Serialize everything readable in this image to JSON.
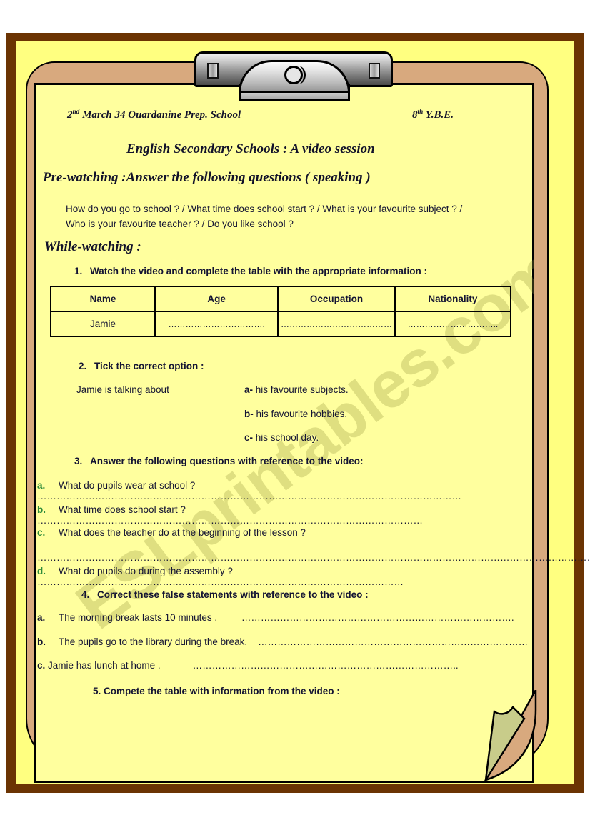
{
  "worksheet": {
    "header": {
      "date_school": "2nd March 34 Ouardanine Prep. School",
      "date_school_sup": "nd",
      "date_school_pre": "2",
      "date_school_post": " March 34 Ouardanine Prep. School",
      "level_pre": "8",
      "level_sup": "th",
      "level_post": " Y.B.E.",
      "level": "8th Y.B.E.",
      "title": "English Secondary Schools : A video session"
    },
    "pre_watching": {
      "heading": "Pre-watching :Answer the following questions ( speaking )",
      "questions_line1": "How do you go to school ? /   What time does school start ?  /  What is your favourite subject ? /",
      "questions_line2": "Who is your favourite teacher ?  /  Do you like school ?"
    },
    "while_watching": {
      "heading": "While-watching :",
      "task1": {
        "number": "1.",
        "text": "Watch the video and complete the table with the appropriate  information :",
        "table": {
          "columns": [
            "Name",
            "Age",
            "Occupation",
            "Nationality"
          ],
          "rows": [
            [
              "Jamie",
              "…………………………….",
              "…………………………………",
              "………………………….."
            ]
          ]
        }
      },
      "task2": {
        "number": "2.",
        "text": "Tick the correct option :",
        "stem": "Jamie is talking about",
        "options": [
          {
            "letter": "a-",
            "text": " his favourite subjects."
          },
          {
            "letter": "b-",
            "text": " his favourite hobbies."
          },
          {
            "letter": "c-",
            "text": " his school day."
          }
        ]
      },
      "task3": {
        "number": "3.",
        "text": "Answer the following questions with reference to the video:",
        "items": [
          {
            "letter": "a.",
            "text": "What do pupils wear at school  ?",
            "dots": "……………………………………………………………………………………………………………………"
          },
          {
            "letter": "b.",
            "text": "What time does school start ?",
            "dots": "…………………………………………………………………………………………………………"
          },
          {
            "letter": "c.",
            "text": "What does the teacher do at the beginning of the lesson ?",
            "dots": "………………………………………………………………………………………………………………………………………………………………………"
          },
          {
            "letter": "d.",
            "text": "What do pupils do during the assembly ?",
            "dots": "……………………………………………………………………………………………………"
          }
        ]
      },
      "task4": {
        "number": "4.",
        "text": "Correct these false statements with reference to the video :",
        "items": [
          {
            "letter": "a.",
            "text": "The morning  break  lasts 10 minutes .",
            "dots": "…………………………………………………………………………."
          },
          {
            "letter": "b.",
            "text": "The pupils go to the library during the break.",
            "dots": "…………………………………………………………………………"
          },
          {
            "letter": "c.",
            "text": "Jamie has lunch at home .",
            "dots": "……………………………………………………………………….."
          }
        ]
      },
      "task5": {
        "number": "5.",
        "text": "Compete the table with information from the video :"
      }
    },
    "watermark": "ESLprintables.com",
    "colors": {
      "outer_frame": "#6b3403",
      "backdrop_yellow": "#ffff80",
      "clipboard_tan": "#d8a97e",
      "paper": "#ffff9e",
      "ink": "#141433",
      "accent_green": "#2e8b3a",
      "curl_shade": "#c8cc8a",
      "metal": "#bdbdbd"
    }
  }
}
